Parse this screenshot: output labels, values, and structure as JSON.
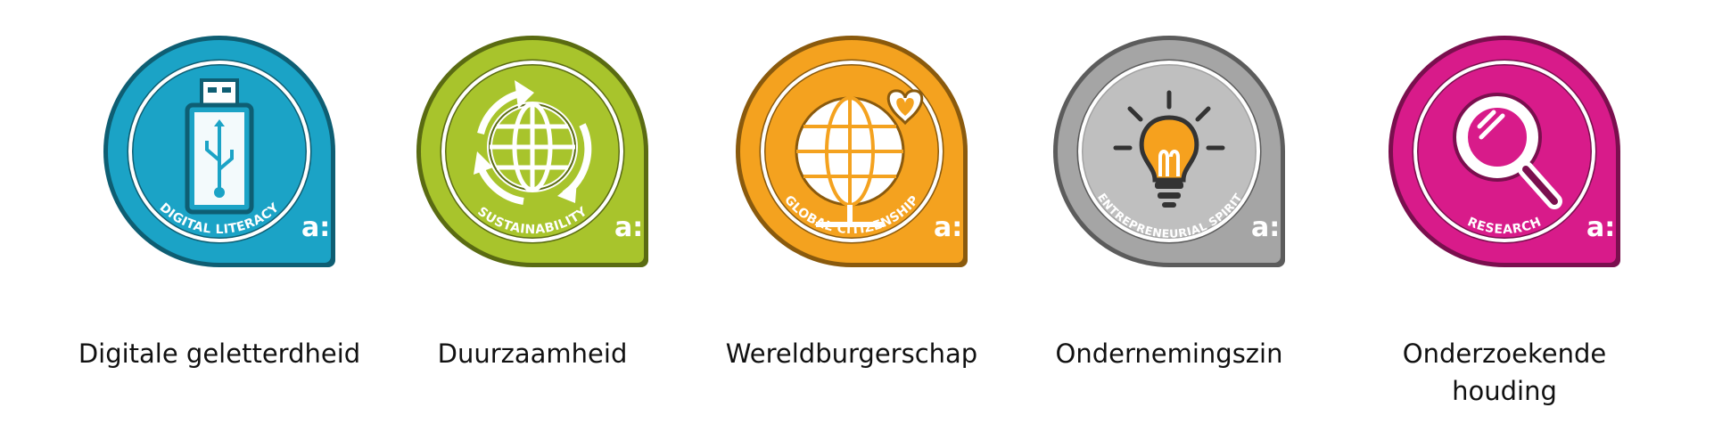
{
  "badges": [
    {
      "arc_label": "DIGITAL LITERACY",
      "caption": "Digitale geletterdheid",
      "color": "#1BA3C6",
      "dark": "#0E5E73",
      "icon": "usb-stick-icon"
    },
    {
      "arc_label": "SUSTAINABILITY",
      "caption": "Duurzaamheid",
      "color": "#A8C42C",
      "dark": "#5A6B12",
      "icon": "recycle-globe-icon"
    },
    {
      "arc_label": "GLOBAL CITIZENSHIP",
      "caption": "Wereldburgerschap",
      "color": "#F4A21F",
      "dark": "#8A5A0D",
      "icon": "globe-heart-icon"
    },
    {
      "arc_label": "ENTREPRENEURIAL SPIRIT",
      "caption": "Ondernemingszin",
      "color": "#A5A5A5",
      "dark": "#5C5C5C",
      "icon": "lightbulb-icon"
    },
    {
      "arc_label": "RESEARCH",
      "caption": "Onderzoekende houding",
      "color": "#D81B8A",
      "dark": "#7A0F4E",
      "icon": "magnifier-icon"
    }
  ],
  "logo_text": "a:"
}
